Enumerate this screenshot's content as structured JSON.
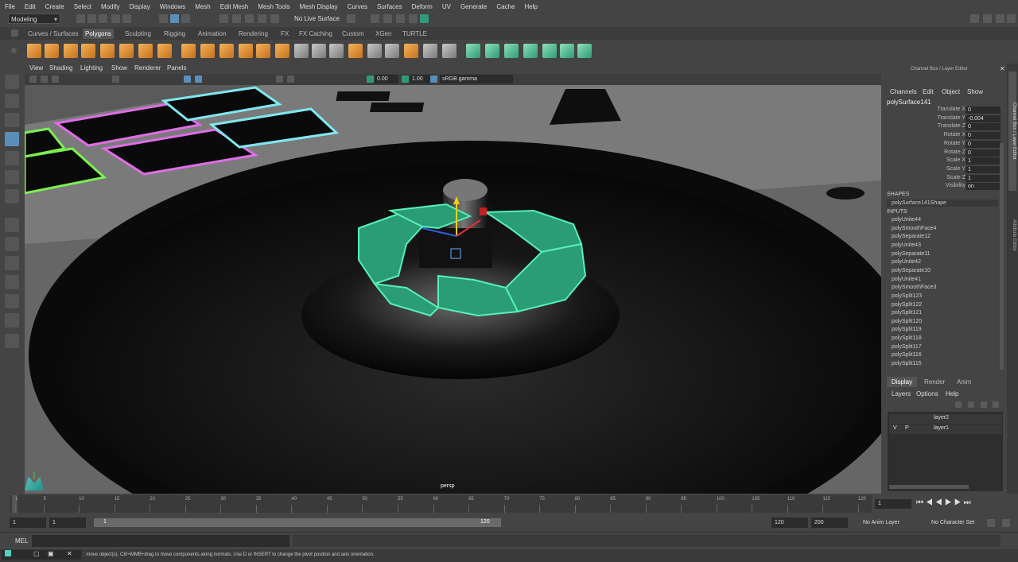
{
  "menubar": [
    "File",
    "Edit",
    "Create",
    "Select",
    "Modify",
    "Display",
    "Windows",
    "Mesh",
    "Edit Mesh",
    "Mesh Tools",
    "Mesh Display",
    "Curves",
    "Surfaces",
    "Deform",
    "UV",
    "Generate",
    "Cache",
    "Help"
  ],
  "status": {
    "mode": "Modeling",
    "live_surface": "No Live Surface"
  },
  "shelf_tabs": [
    "Curves / Surfaces",
    "Polygons",
    "Sculpting",
    "Rigging",
    "Animation",
    "Rendering",
    "FX",
    "FX Caching",
    "Custom",
    "XGen",
    "TURTLE"
  ],
  "shelf_active": "Polygons",
  "viewport": {
    "menu": [
      "View",
      "Shading",
      "Lighting",
      "Show",
      "Renderer",
      "Panels"
    ],
    "field1": "0.00",
    "field2": "1.00",
    "colorspace": "sRGB gamma",
    "camera_label": "persp",
    "accent_select": "#47e8a8"
  },
  "channel_box": {
    "header": "Channel Box / Layer Editor",
    "menu": [
      "Channels",
      "Edit",
      "Object",
      "Show"
    ],
    "object": "polySurface141",
    "attributes": [
      {
        "label": "Translate X",
        "value": "0"
      },
      {
        "label": "Translate Y",
        "value": "-0.004"
      },
      {
        "label": "Translate Z",
        "value": "0"
      },
      {
        "label": "Rotate X",
        "value": "0"
      },
      {
        "label": "Rotate Y",
        "value": "0"
      },
      {
        "label": "Rotate Z",
        "value": "0"
      },
      {
        "label": "Scale X",
        "value": "1"
      },
      {
        "label": "Scale Y",
        "value": "1"
      },
      {
        "label": "Scale Z",
        "value": "1"
      },
      {
        "label": "Visibility",
        "value": "on"
      }
    ],
    "shapes_header": "SHAPES",
    "shape": "polySurface141Shape",
    "inputs_header": "INPUTS",
    "inputs": [
      "polyUnite44",
      "polySmoothFace4",
      "polySeparate12",
      "polyUnite43",
      "polySeparate11",
      "polyUnite42",
      "polySeparate10",
      "polyUnite41",
      "polySmoothFace3",
      "polySplit123",
      "polySplit122",
      "polySplit121",
      "polySplit120",
      "polySplit119",
      "polySplit118",
      "polySplit117",
      "polySplit116",
      "polySplit115"
    ]
  },
  "side_tabs": [
    "Channel Box / Layer Editor",
    "Attribute Editor"
  ],
  "layer_editor": {
    "tabs": [
      "Display",
      "Render",
      "Anim"
    ],
    "menu": [
      "Layers",
      "Options",
      "Help"
    ],
    "layers": [
      {
        "v": "",
        "p": "",
        "name": "layer2"
      },
      {
        "v": "V",
        "p": "P",
        "name": "layer1"
      }
    ]
  },
  "timeline": {
    "ticks": [
      "1",
      "5",
      "10",
      "15",
      "20",
      "25",
      "30",
      "35",
      "40",
      "45",
      "50",
      "55",
      "60",
      "65",
      "70",
      "75",
      "80",
      "85",
      "90",
      "95",
      "100",
      "105",
      "110",
      "115",
      "120"
    ],
    "current_frame": "1"
  },
  "range": {
    "start": "1",
    "playback_start": "1",
    "slider_start": "1",
    "slider_end": "120",
    "playback_end": "120",
    "end": "200",
    "anim_layer": "No Anim Layer",
    "character_set": "No Character Set"
  },
  "command": {
    "lang": "MEL"
  },
  "help": {
    "text": ": move object(s). Ctrl+MMB+drag to move components along normals. Use D or INSERT to change the pivot position and axis orientation."
  }
}
